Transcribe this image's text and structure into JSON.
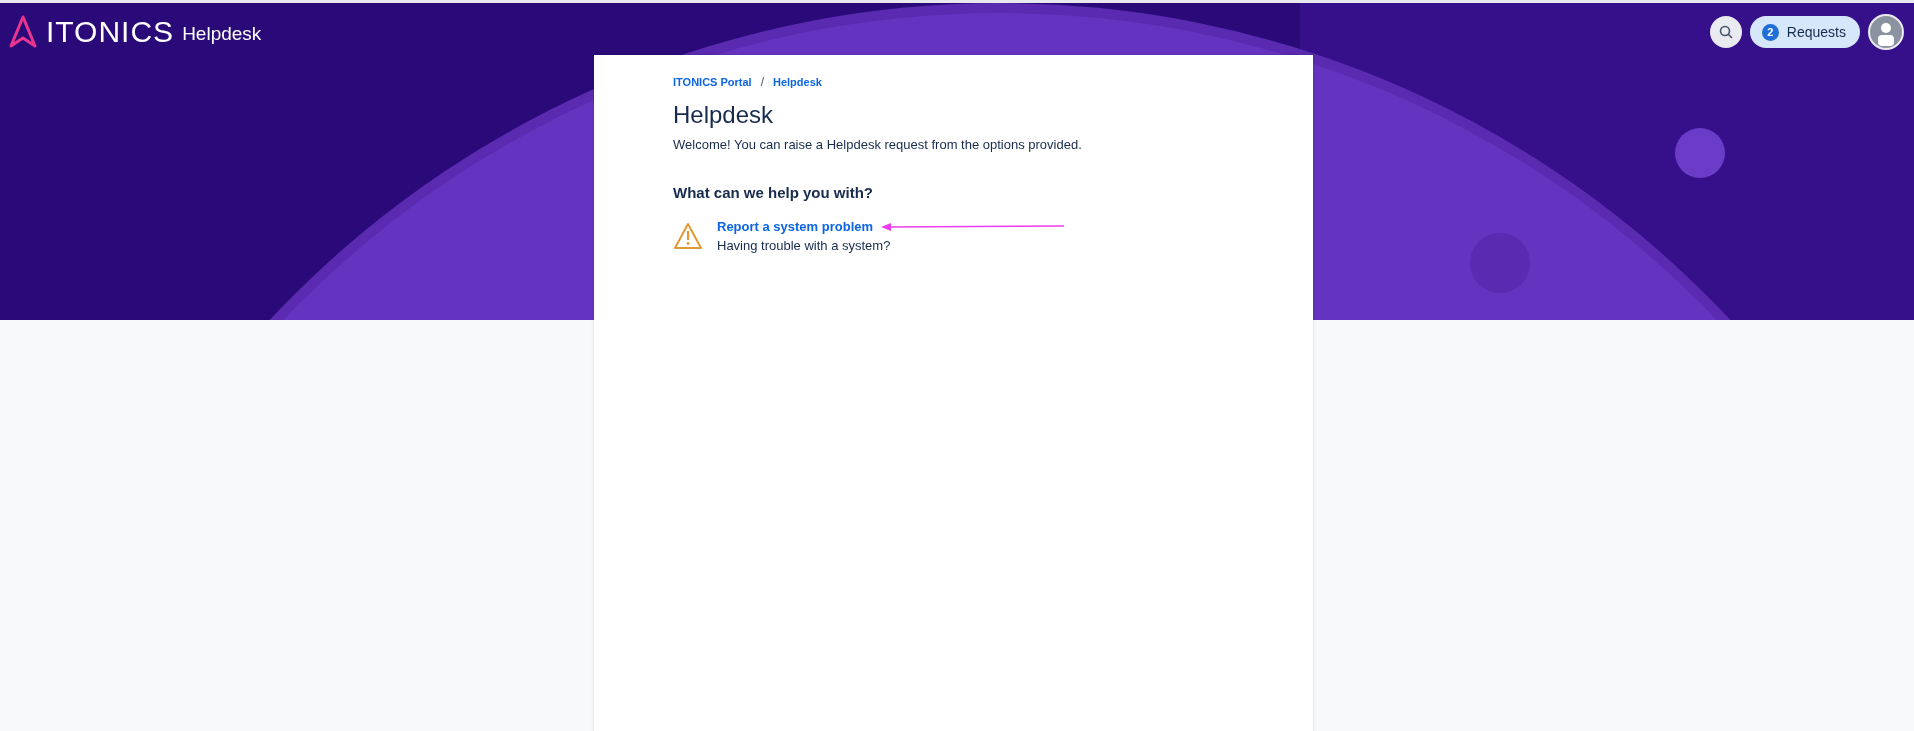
{
  "header": {
    "brand": "ITONICS",
    "product": "Helpdesk",
    "requests": {
      "count": "2",
      "label": "Requests"
    }
  },
  "breadcrumbs": [
    {
      "label": "ITONICS Portal"
    },
    {
      "label": "Helpdesk"
    }
  ],
  "breadcrumb_separator": "/",
  "title": "Helpdesk",
  "intro": "Welcome! You can raise a Helpdesk request from the options provided.",
  "section_title": "What can we help you with?",
  "request_types": [
    {
      "title": "Report a system problem",
      "description": "Having trouble with a system?"
    }
  ]
}
